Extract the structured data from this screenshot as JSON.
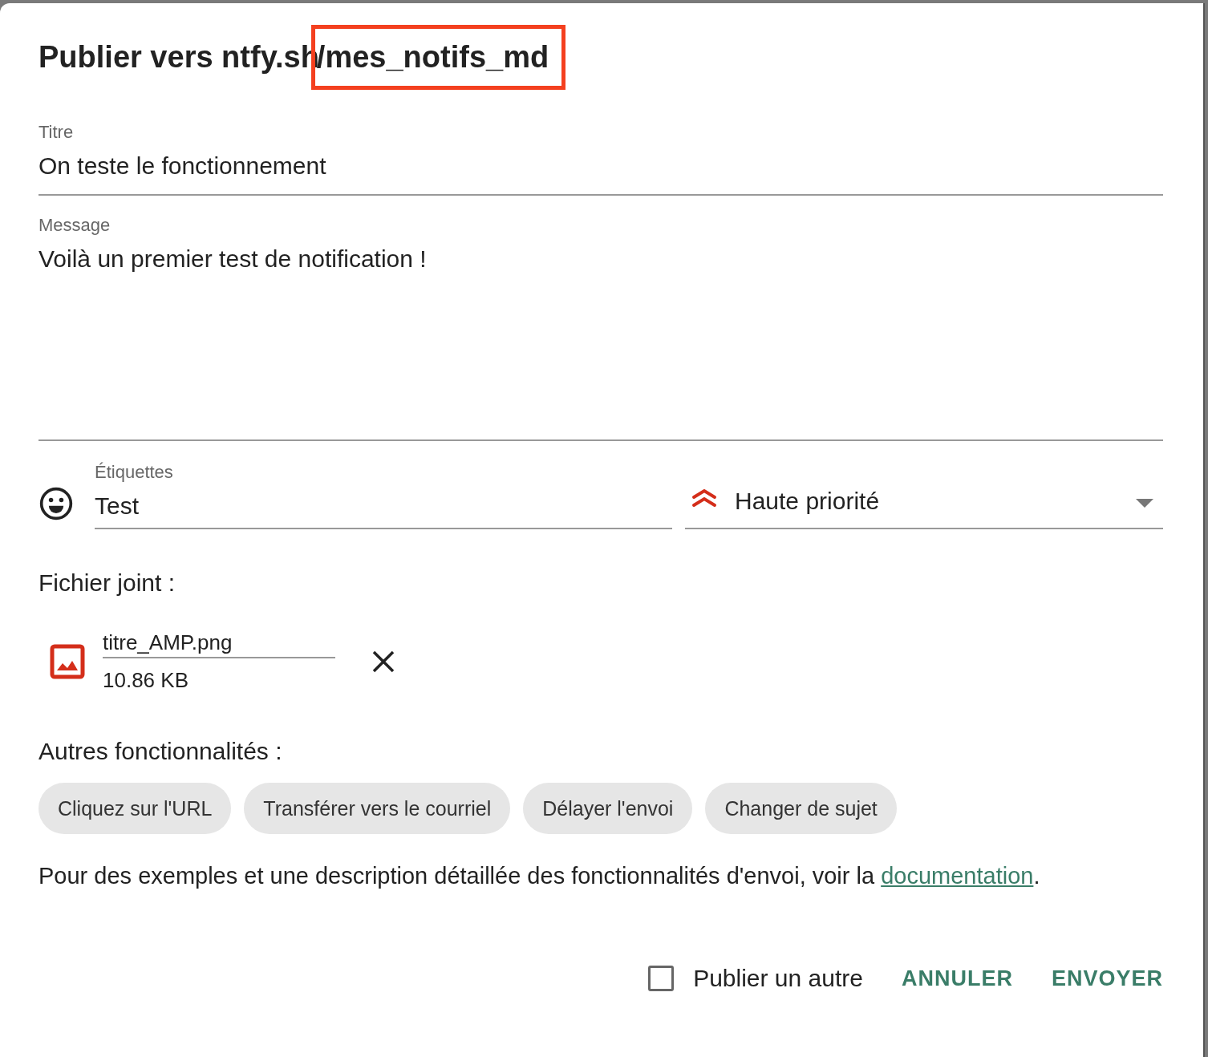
{
  "dialog": {
    "title": "Publier vers ntfy.sh",
    "topic": "/mes_notifs_md"
  },
  "title_field": {
    "label": "Titre",
    "value": "On teste le fonctionnement"
  },
  "message_field": {
    "label": "Message",
    "value": "Voilà un premier test de notification !"
  },
  "tags_field": {
    "label": "Étiquettes",
    "value": "Test"
  },
  "priority": {
    "value": "Haute priorité"
  },
  "attachment": {
    "heading": "Fichier joint :",
    "name": "titre_AMP.png",
    "size": "10.86 KB"
  },
  "features": {
    "heading": "Autres fonctionnalités :",
    "chips": [
      {
        "label": "Cliquez sur l'URL"
      },
      {
        "label": "Transférer vers le courriel"
      },
      {
        "label": "Délayer l'envoi"
      },
      {
        "label": "Changer de sujet"
      }
    ]
  },
  "help": {
    "text": "Pour des exemples et une description détaillée des fonctionnalités d'envoi, voir la",
    "link": "documentation",
    "suffix": "."
  },
  "footer": {
    "checkbox": {
      "label": "Publier un autre",
      "checked": false
    },
    "buttons": [
      {
        "label": "ANNULER"
      },
      {
        "label": "ENVOYER"
      }
    ]
  }
}
